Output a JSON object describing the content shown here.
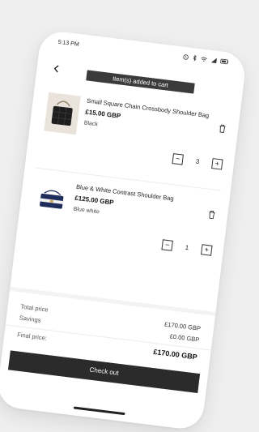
{
  "status_bar": {
    "time": "5:13 PM"
  },
  "toast": {
    "text": "Item(s) added to cart"
  },
  "cart": {
    "items": [
      {
        "name": "Small Square Chain Crossbody Shoulder Bag",
        "price": "£15.00 GBP",
        "color": "Black",
        "quantity": "3"
      },
      {
        "name": "Blue & White Contrast Shoulder Bag",
        "price": "£125.00 GBP",
        "color": "Blue white",
        "quantity": "1"
      }
    ]
  },
  "summary": {
    "total_label": "Total price",
    "total_value": "£170.00 GBP",
    "savings_label": "Savings",
    "savings_value": "£0.00 GBP",
    "final_label": "Final price:",
    "final_value": "£170.00 GBP"
  },
  "checkout": {
    "label": "Check out"
  },
  "qty_controls": {
    "minus": "−",
    "plus": "+"
  }
}
